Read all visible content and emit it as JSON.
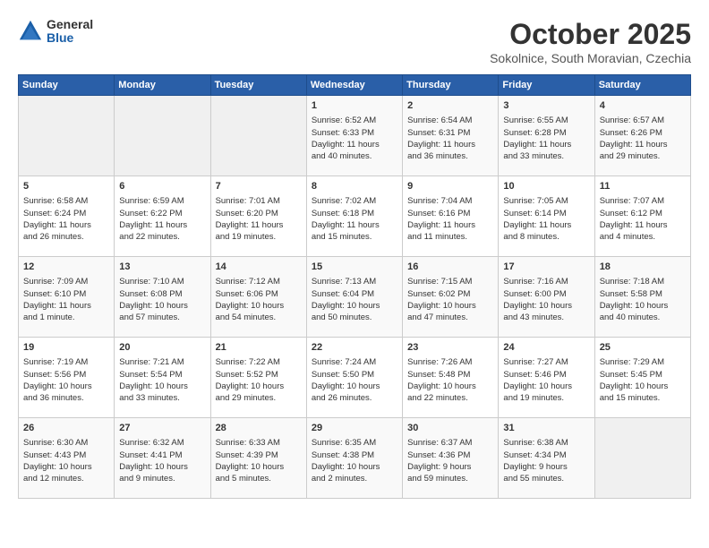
{
  "header": {
    "logo_general": "General",
    "logo_blue": "Blue",
    "month_title": "October 2025",
    "location": "Sokolnice, South Moravian, Czechia"
  },
  "days_of_week": [
    "Sunday",
    "Monday",
    "Tuesday",
    "Wednesday",
    "Thursday",
    "Friday",
    "Saturday"
  ],
  "weeks": [
    [
      {
        "day": "",
        "content": ""
      },
      {
        "day": "",
        "content": ""
      },
      {
        "day": "",
        "content": ""
      },
      {
        "day": "1",
        "content": "Sunrise: 6:52 AM\nSunset: 6:33 PM\nDaylight: 11 hours\nand 40 minutes."
      },
      {
        "day": "2",
        "content": "Sunrise: 6:54 AM\nSunset: 6:31 PM\nDaylight: 11 hours\nand 36 minutes."
      },
      {
        "day": "3",
        "content": "Sunrise: 6:55 AM\nSunset: 6:28 PM\nDaylight: 11 hours\nand 33 minutes."
      },
      {
        "day": "4",
        "content": "Sunrise: 6:57 AM\nSunset: 6:26 PM\nDaylight: 11 hours\nand 29 minutes."
      }
    ],
    [
      {
        "day": "5",
        "content": "Sunrise: 6:58 AM\nSunset: 6:24 PM\nDaylight: 11 hours\nand 26 minutes."
      },
      {
        "day": "6",
        "content": "Sunrise: 6:59 AM\nSunset: 6:22 PM\nDaylight: 11 hours\nand 22 minutes."
      },
      {
        "day": "7",
        "content": "Sunrise: 7:01 AM\nSunset: 6:20 PM\nDaylight: 11 hours\nand 19 minutes."
      },
      {
        "day": "8",
        "content": "Sunrise: 7:02 AM\nSunset: 6:18 PM\nDaylight: 11 hours\nand 15 minutes."
      },
      {
        "day": "9",
        "content": "Sunrise: 7:04 AM\nSunset: 6:16 PM\nDaylight: 11 hours\nand 11 minutes."
      },
      {
        "day": "10",
        "content": "Sunrise: 7:05 AM\nSunset: 6:14 PM\nDaylight: 11 hours\nand 8 minutes."
      },
      {
        "day": "11",
        "content": "Sunrise: 7:07 AM\nSunset: 6:12 PM\nDaylight: 11 hours\nand 4 minutes."
      }
    ],
    [
      {
        "day": "12",
        "content": "Sunrise: 7:09 AM\nSunset: 6:10 PM\nDaylight: 11 hours\nand 1 minute."
      },
      {
        "day": "13",
        "content": "Sunrise: 7:10 AM\nSunset: 6:08 PM\nDaylight: 10 hours\nand 57 minutes."
      },
      {
        "day": "14",
        "content": "Sunrise: 7:12 AM\nSunset: 6:06 PM\nDaylight: 10 hours\nand 54 minutes."
      },
      {
        "day": "15",
        "content": "Sunrise: 7:13 AM\nSunset: 6:04 PM\nDaylight: 10 hours\nand 50 minutes."
      },
      {
        "day": "16",
        "content": "Sunrise: 7:15 AM\nSunset: 6:02 PM\nDaylight: 10 hours\nand 47 minutes."
      },
      {
        "day": "17",
        "content": "Sunrise: 7:16 AM\nSunset: 6:00 PM\nDaylight: 10 hours\nand 43 minutes."
      },
      {
        "day": "18",
        "content": "Sunrise: 7:18 AM\nSunset: 5:58 PM\nDaylight: 10 hours\nand 40 minutes."
      }
    ],
    [
      {
        "day": "19",
        "content": "Sunrise: 7:19 AM\nSunset: 5:56 PM\nDaylight: 10 hours\nand 36 minutes."
      },
      {
        "day": "20",
        "content": "Sunrise: 7:21 AM\nSunset: 5:54 PM\nDaylight: 10 hours\nand 33 minutes."
      },
      {
        "day": "21",
        "content": "Sunrise: 7:22 AM\nSunset: 5:52 PM\nDaylight: 10 hours\nand 29 minutes."
      },
      {
        "day": "22",
        "content": "Sunrise: 7:24 AM\nSunset: 5:50 PM\nDaylight: 10 hours\nand 26 minutes."
      },
      {
        "day": "23",
        "content": "Sunrise: 7:26 AM\nSunset: 5:48 PM\nDaylight: 10 hours\nand 22 minutes."
      },
      {
        "day": "24",
        "content": "Sunrise: 7:27 AM\nSunset: 5:46 PM\nDaylight: 10 hours\nand 19 minutes."
      },
      {
        "day": "25",
        "content": "Sunrise: 7:29 AM\nSunset: 5:45 PM\nDaylight: 10 hours\nand 15 minutes."
      }
    ],
    [
      {
        "day": "26",
        "content": "Sunrise: 6:30 AM\nSunset: 4:43 PM\nDaylight: 10 hours\nand 12 minutes."
      },
      {
        "day": "27",
        "content": "Sunrise: 6:32 AM\nSunset: 4:41 PM\nDaylight: 10 hours\nand 9 minutes."
      },
      {
        "day": "28",
        "content": "Sunrise: 6:33 AM\nSunset: 4:39 PM\nDaylight: 10 hours\nand 5 minutes."
      },
      {
        "day": "29",
        "content": "Sunrise: 6:35 AM\nSunset: 4:38 PM\nDaylight: 10 hours\nand 2 minutes."
      },
      {
        "day": "30",
        "content": "Sunrise: 6:37 AM\nSunset: 4:36 PM\nDaylight: 9 hours\nand 59 minutes."
      },
      {
        "day": "31",
        "content": "Sunrise: 6:38 AM\nSunset: 4:34 PM\nDaylight: 9 hours\nand 55 minutes."
      },
      {
        "day": "",
        "content": ""
      }
    ]
  ]
}
